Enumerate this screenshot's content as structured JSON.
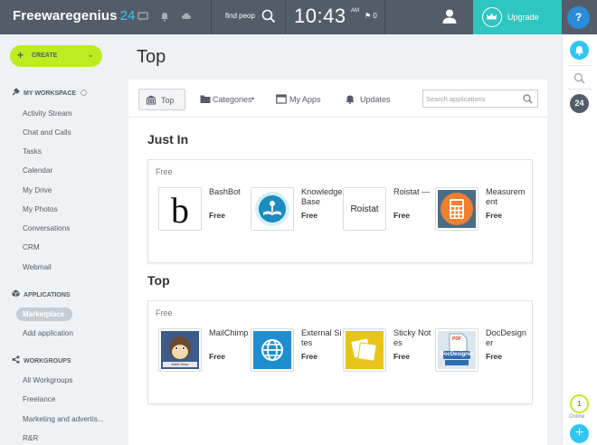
{
  "header": {
    "logo_main": "Freewaregenius",
    "logo_num": "24",
    "search_value": "find peop",
    "clock": "10:43",
    "clock_suffix": "AM",
    "flag_count": "0",
    "upgrade_label": "Upgrade",
    "help_label": "?"
  },
  "sidebar": {
    "create_label": "CREATE",
    "my_workspace": "MY WORKSPACE",
    "workspace_items": [
      "Activity Stream",
      "Chat and Calls",
      "Tasks",
      "Calendar",
      "My Drive",
      "My Photos",
      "Conversations",
      "CRM",
      "Webmail"
    ],
    "applications": "APPLICATIONS",
    "marketplace": "Marketplace",
    "add_application": "Add application",
    "workgroups": "WORKGROUPS",
    "workgroup_items": [
      "All Workgroups",
      "Freelance",
      "Marketing and advertis...",
      "R&R"
    ]
  },
  "main": {
    "title": "Top",
    "tabs": [
      "Top",
      "Categories",
      "My Apps",
      "Updates"
    ],
    "search_placeholder": "Search applications",
    "sections": [
      {
        "title": "Just In",
        "free_label": "Free",
        "apps": [
          {
            "name": "BashBot",
            "price": "Free"
          },
          {
            "name": "Knowledge Base",
            "price": "Free"
          },
          {
            "name": "Roistat — ",
            "price": "Free"
          },
          {
            "name": "Measurement",
            "price": "Free"
          }
        ]
      },
      {
        "title": "Top",
        "free_label": "Free",
        "apps": [
          {
            "name": "MailChimp",
            "price": "Free"
          },
          {
            "name": "External Sites",
            "price": "Free"
          },
          {
            "name": "Sticky Notes",
            "price": "Free"
          },
          {
            "name": "DocDesigner",
            "price": "Free"
          }
        ]
      }
    ],
    "thumb_text": {
      "roistat": "Roistat",
      "mailchimp": "MailChimp",
      "docdesigner": "DocDesigner",
      "pdf": "PDF"
    }
  },
  "rightbar": {
    "badge_24": "24",
    "online_count": "1",
    "online_label": "Online",
    "plus": "+"
  },
  "colors": {
    "header_bg": "#535c69",
    "accent_blue": "#2fc6f6",
    "upgrade_teal": "#2fc6c1",
    "create_green": "#bbed21"
  }
}
